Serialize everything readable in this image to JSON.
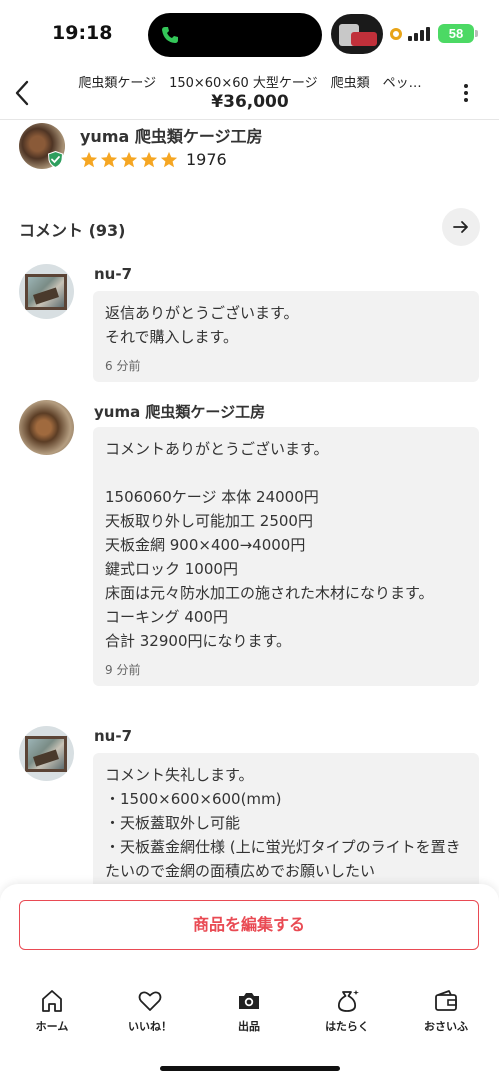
{
  "status_bar": {
    "time": "19:18",
    "battery": "58"
  },
  "header": {
    "title": "爬虫類ケージ　150×60×60 大型ケージ　爬虫類　ペッ…",
    "price": "¥36,000"
  },
  "seller": {
    "name": "yuma 爬虫類ケージ工房",
    "rating_count": "1976",
    "stars": 5
  },
  "comments_section": {
    "label": "コメント (93)"
  },
  "comments": [
    {
      "name": "nu-7",
      "text": "返信ありがとうございます。\nそれで購入します。",
      "time": "6 分前"
    },
    {
      "name": "yuma 爬虫類ケージ工房",
      "text": "コメントありがとうございます。\n\n1506060ケージ 本体 24000円\n天板取り外し可能加工 2500円\n天板金網 900×400→4000円\n鍵式ロック 1000円\n床面は元々防水加工の施された木材になります。\nコーキング 400円\n合計 32900円になります。",
      "time": "9 分前"
    },
    {
      "name": "nu-7",
      "text": "コメント失礼します。\n・1500×600×600(mm)\n・天板蓋取外し可能\n・天板蓋金網仕様 (上に蛍光灯タイプのライトを置きたいので金網の面積広めでお願いしたい",
      "time": ""
    }
  ],
  "edit_button": "商品を編集する",
  "nav": {
    "items": [
      {
        "label": "ホーム",
        "icon": "home-icon"
      },
      {
        "label": "いいね！",
        "icon": "heart-icon"
      },
      {
        "label": "出品",
        "icon": "camera-icon"
      },
      {
        "label": "はたらく",
        "icon": "money-bag-icon"
      },
      {
        "label": "おさいふ",
        "icon": "wallet-icon"
      }
    ]
  },
  "colors": {
    "accent": "#e94a53",
    "star": "#f5a623",
    "bubble_bg": "#f2f2f2",
    "verified": "#2e9e5e"
  }
}
